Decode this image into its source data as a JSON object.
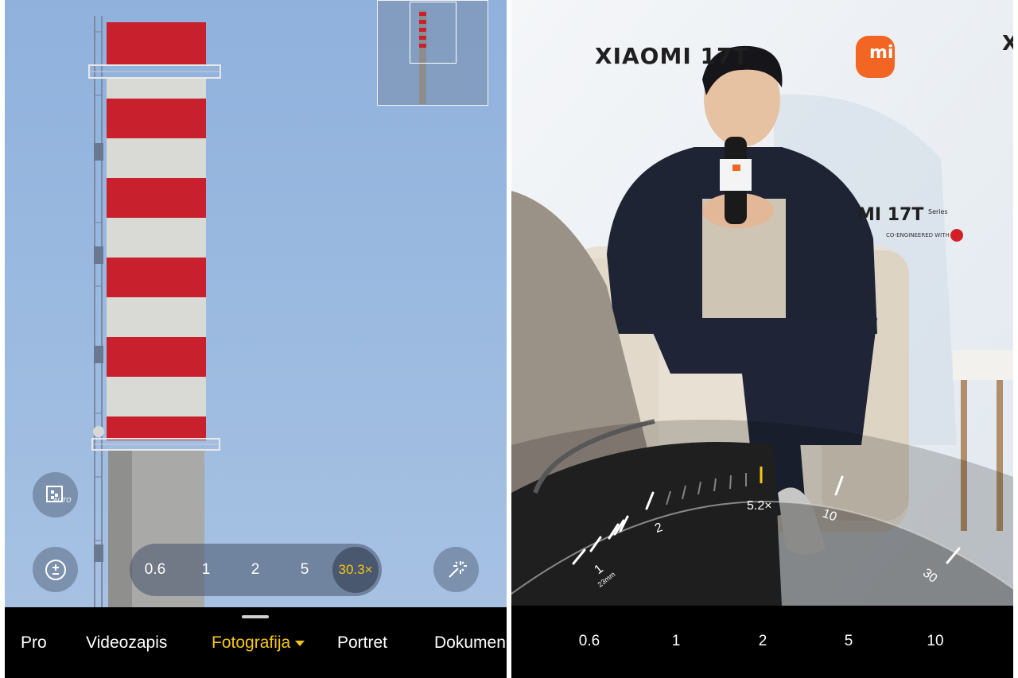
{
  "left_screen": {
    "zoom_options": [
      "0.6",
      "1",
      "2",
      "5"
    ],
    "zoom_active": "30.3×",
    "icons": {
      "auto_mode": "auto-scene-icon",
      "exposure": "exposure-icon",
      "magic": "sparkle-wand-icon"
    },
    "auto_badge": "AUTO",
    "modes": [
      "Pro",
      "Videozapis",
      "Fotografija",
      "Portret",
      "Dokumen"
    ],
    "active_mode": "Fotografija"
  },
  "right_screen": {
    "backdrop": {
      "brand_top": "XIAOMI 17T",
      "brand_mid": "MI 17T",
      "series": "Series",
      "coengineered": "CO-ENGINEERED WITH",
      "logo": "mi",
      "partial": "X"
    },
    "dial": {
      "current": "5.2×",
      "labels": [
        "1",
        "2",
        "10",
        "30"
      ],
      "focal": "23mm"
    },
    "zoom_options": [
      "0.6",
      "1",
      "2",
      "5",
      "10"
    ]
  },
  "colors": {
    "accent": "#f5c518",
    "chimney_red": "#c8202c",
    "chimney_white": "#d9d9d6",
    "sky": "#9ab9e0",
    "mi_orange": "#f26522"
  }
}
